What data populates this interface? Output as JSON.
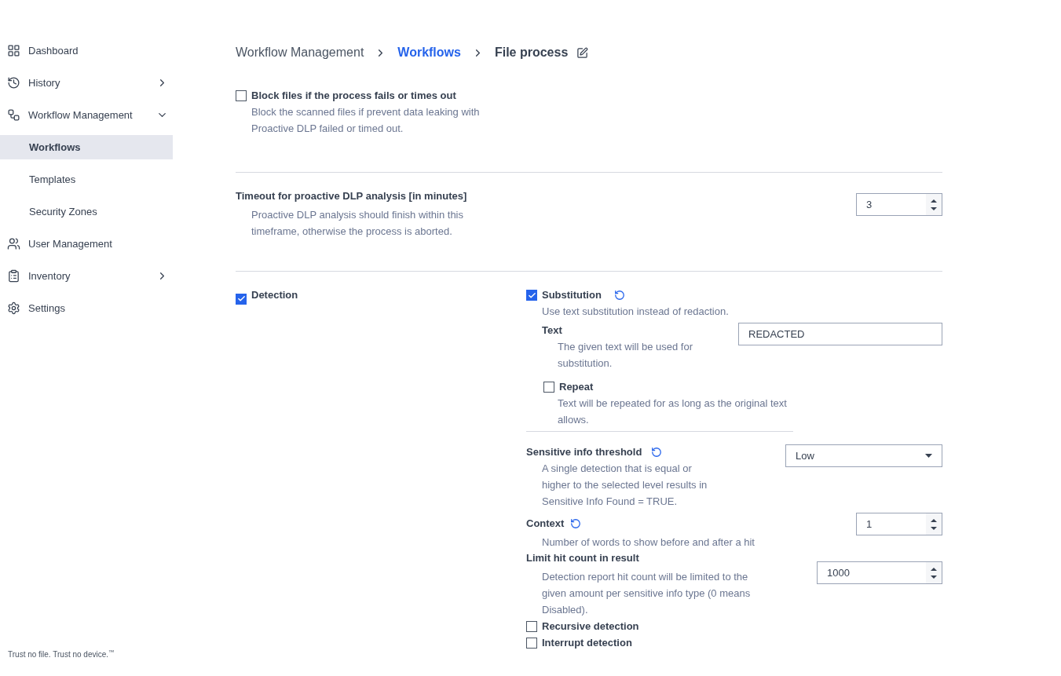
{
  "sidebar": {
    "items": [
      {
        "label": "Dashboard",
        "expandable": false,
        "selected": false
      },
      {
        "label": "History",
        "expandable": true,
        "expanded": false,
        "selected": false
      },
      {
        "label": "Workflow Management",
        "expandable": true,
        "expanded": true,
        "selected": false,
        "children": [
          {
            "label": "Workflows",
            "selected": true
          },
          {
            "label": "Templates",
            "selected": false
          },
          {
            "label": "Security Zones",
            "selected": false
          }
        ]
      },
      {
        "label": "User Management",
        "expandable": false,
        "selected": false
      },
      {
        "label": "Inventory",
        "expandable": true,
        "expanded": false,
        "selected": false
      },
      {
        "label": "Settings",
        "expandable": false,
        "selected": false
      }
    ],
    "tagline": "Trust no file. Trust no device.$^{™}$"
  },
  "breadcrumb": [
    {
      "label": "Workflow Management",
      "kind": "parent"
    },
    {
      "label": "Workflows",
      "kind": "link"
    },
    {
      "label": "File process",
      "kind": "current"
    }
  ],
  "block_files": {
    "label": "Block files if the process fails or times out",
    "checked": false,
    "description": "Block the scanned files if prevent data leaking with Proactive DLP failed or timed out."
  },
  "timeout": {
    "label": "Timeout for proactive DLP analysis [in minutes]",
    "description": "Proactive DLP analysis should finish within this timeframe, otherwise the process is aborted.",
    "value": "3"
  },
  "detection": {
    "label": "Detection",
    "checked": true,
    "substitution": {
      "label": "Substitution",
      "checked": true,
      "description": "Use text substitution instead of redaction.",
      "text": {
        "label": "Text",
        "description": "The given text will be used for substitution.",
        "value": "REDACTED"
      },
      "repeat": {
        "label": "Repeat",
        "checked": false,
        "description": "Text will be repeated for as long as the original text allows."
      }
    },
    "threshold": {
      "label": "Sensitive info threshold",
      "description": "A single detection that is equal or higher to the selected level results in Sensitive Info Found = TRUE.",
      "value": "Low"
    },
    "context": {
      "label": "Context",
      "description": "Number of words to show before and after a hit",
      "value": "1"
    },
    "limit": {
      "label": "Limit hit count in result",
      "description": "Detection report hit count will be limited to the given amount per sensitive info type (0 means Disabled).",
      "value": "1000"
    },
    "options": [
      {
        "label": "Recursive detection",
        "checked": false
      },
      {
        "label": "Interrupt detection",
        "checked": false
      }
    ]
  }
}
